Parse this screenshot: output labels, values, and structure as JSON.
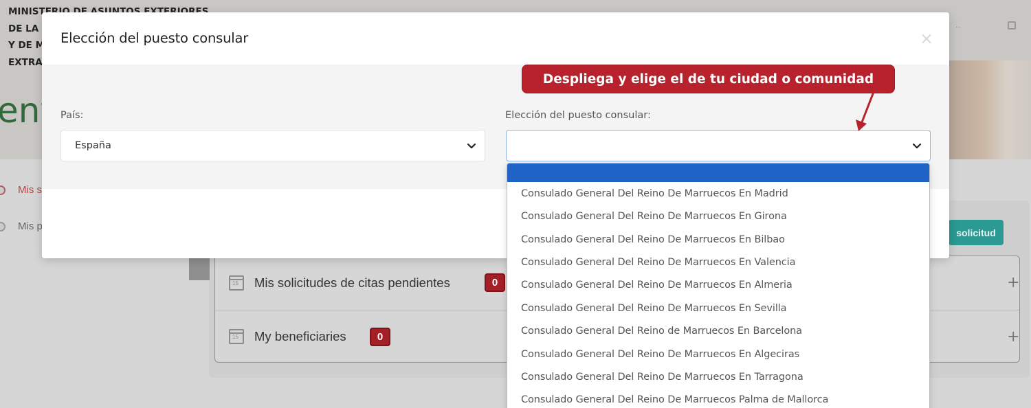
{
  "background": {
    "ministry_lines": [
      "MINISTERIO DE ASUNTOS EXTERIORES",
      "DE LA C",
      "Y DE M",
      "EXTRA"
    ],
    "big_word": "env",
    "top_right_text": "...",
    "sidebar": [
      {
        "label": "Mis s",
        "active": true
      },
      {
        "label": "Mis p",
        "active": false
      }
    ],
    "rows": [
      {
        "label": "Mis solicitudes de citas pendientes",
        "count": "0"
      },
      {
        "label": "My beneficiaries",
        "count": "0"
      }
    ],
    "solicitud_button": "solicitud"
  },
  "modal": {
    "title": "Elección del puesto consular",
    "close_glyph": "×",
    "country_label": "País:",
    "country_value": "España",
    "post_label": "Elección del puesto consular:",
    "post_value": ""
  },
  "annotation": {
    "text": "Despliega y elige el de tu ciudad o comunidad",
    "color": "#b8222c"
  },
  "dropdown": {
    "selected_color": "#1f63c6",
    "options": [
      "Consulado General Del Reino De Marruecos En Madrid",
      "Consulado General Del Reino De Marruecos En Girona",
      "Consulado General Del Reino De Marruecos En Bilbao",
      "Consulado General Del Reino De Marruecos En Valencia",
      "Consulado General Del Reino De Marruecos En Almeria",
      "Consulado General Del Reino De Marruecos En Sevilla",
      "Consulado General Del Reino de Marruecos En Barcelona",
      "Consulado General Del Reino De Marruecos En Algeciras",
      "Consulado General Del Reino De Marruecos En Tarragona",
      "Consulado General Del Reino De Marruecos Palma de Mallorca"
    ]
  },
  "colors": {
    "badge": "#a51f26",
    "teal_button": "#2b9a92"
  }
}
